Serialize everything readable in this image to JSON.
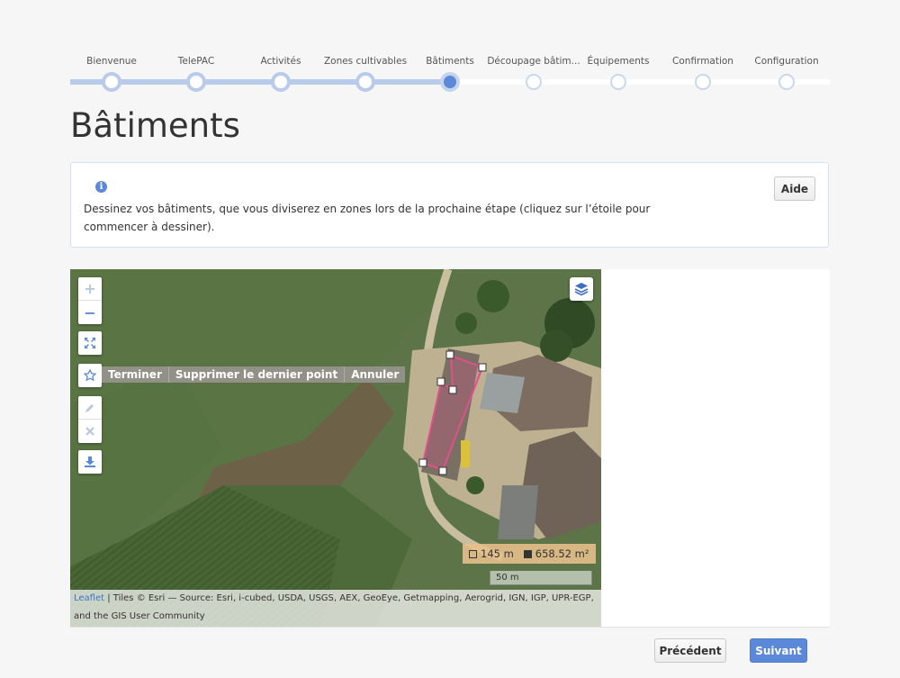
{
  "stepper": {
    "steps": [
      {
        "label": "Bienvenue",
        "state": "done"
      },
      {
        "label": "TelePAC",
        "state": "done"
      },
      {
        "label": "Activités",
        "state": "done"
      },
      {
        "label": "Zones cultivables",
        "state": "done"
      },
      {
        "label": "Bâtiments",
        "state": "current"
      },
      {
        "label": "Découpage bâtim...",
        "state": "todo"
      },
      {
        "label": "Équipements",
        "state": "todo"
      },
      {
        "label": "Confirmation",
        "state": "todo"
      },
      {
        "label": "Configuration",
        "state": "todo"
      }
    ]
  },
  "page": {
    "title": "Bâtiments"
  },
  "info": {
    "icon": "info-icon",
    "text": "Dessinez vos bâtiments, que vous diviserez en zones lors de la prochaine étape (cliquez sur l’étoile pour commencer à dessiner).",
    "help_label": "Aide"
  },
  "map": {
    "zoom_in": "+",
    "zoom_out": "−",
    "draw_actions": {
      "finish": "Terminer",
      "delete_last": "Supprimer le dernier point",
      "cancel": "Annuler"
    },
    "measure": {
      "perimeter": "145 m",
      "area": "658.52 m²"
    },
    "scale_label": "50 m",
    "attribution": {
      "link": "Leaflet",
      "text": " | Tiles © Esri — Source: Esri, i-cubed, USDA, USGS, AEX, GeoEye, Getmapping, Aerogrid, IGN, IGP, UPR-EGP, and the GIS User Community"
    },
    "colors": {
      "polygon": "#e0508a",
      "accent": "#5b88d8"
    }
  },
  "footer": {
    "prev_label": "Précédent",
    "next_label": "Suivant"
  }
}
